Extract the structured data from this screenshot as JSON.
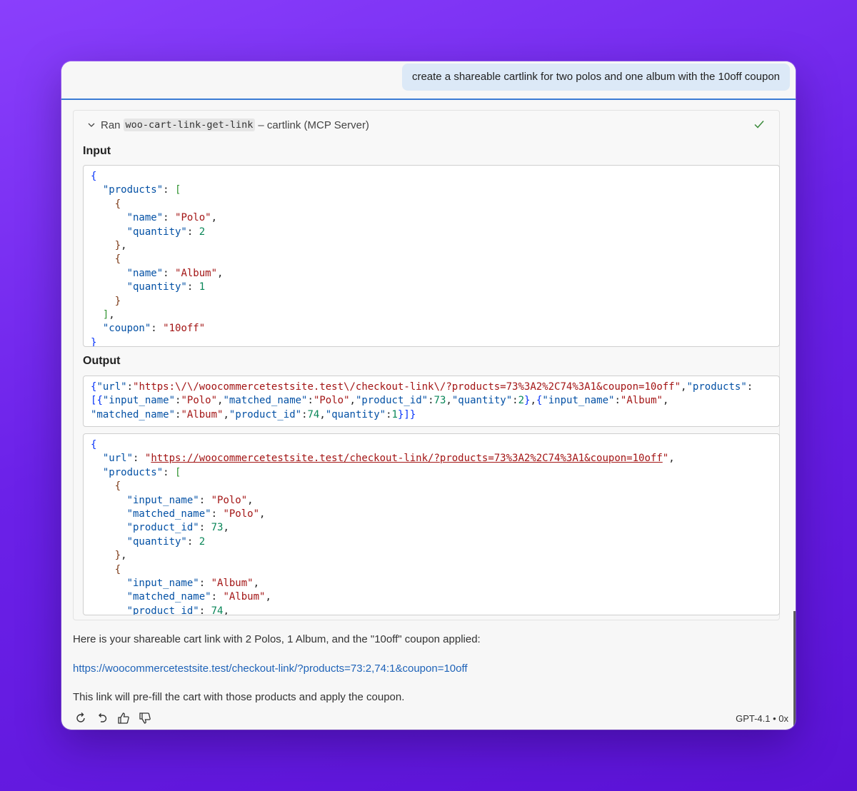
{
  "user_message": "create a shareable cartlink for two polos and one album with the 10off coupon",
  "tool_call": {
    "prefix": "Ran",
    "tool_name": "woo-cart-link-get-link",
    "suffix": "– cartlink (MCP Server)",
    "input_label": "Input",
    "output_label": "Output"
  },
  "input_json": {
    "products": [
      {
        "name": "Polo",
        "quantity": 2
      },
      {
        "name": "Album",
        "quantity": 1
      }
    ],
    "coupon": "10off"
  },
  "raw_output": "{\"url\":\"https:\\/\\/woocommercetestsite.test\\/checkout-link\\/?products=73%3A2%2C74%3A1&coupon=10off\",\"products\":[{\"input_name\":\"Polo\",\"matched_name\":\"Polo\",\"product_id\":73,\"quantity\":2},{\"input_name\":\"Album\",\"matched_name\":\"Album\",\"product_id\":74,\"quantity\":1}]}",
  "output_json": {
    "url": "https://woocommercetestsite.test/checkout-link/?products=73%3A2%2C74%3A1&coupon=10off",
    "products": [
      {
        "input_name": "Polo",
        "matched_name": "Polo",
        "product_id": 73,
        "quantity": 2
      },
      {
        "input_name": "Album",
        "matched_name": "Album",
        "product_id": 74
      }
    ]
  },
  "response": {
    "intro": "Here is your shareable cart link with 2 Polos, 1 Album, and the \"10off\" coupon applied:",
    "link": "https://woocommercetestsite.test/checkout-link/?products=73:2,74:1&coupon=10off",
    "outro": "This link will pre-fill the cart with those products and apply the coupon."
  },
  "footer": {
    "model": "GPT-4.1 • 0x",
    "icons": [
      "retry-icon",
      "undo-icon",
      "thumbs-up-icon",
      "thumbs-down-icon"
    ]
  }
}
